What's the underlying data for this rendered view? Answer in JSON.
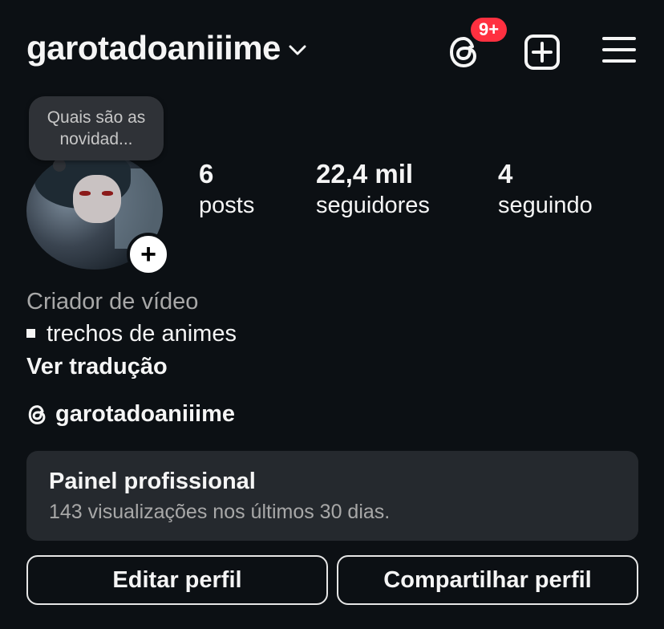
{
  "header": {
    "username": "garotadoaniiime",
    "threads_badge": "9+"
  },
  "note": {
    "text": "Quais são as novidad..."
  },
  "stats": {
    "posts": {
      "count": "6",
      "label": "posts"
    },
    "followers": {
      "count": "22,4 mil",
      "label": "seguidores"
    },
    "following": {
      "count": "4",
      "label": "seguindo"
    }
  },
  "bio": {
    "category": "Criador de vídeo",
    "line": "trechos de animes",
    "translate_label": "Ver tradução",
    "threads_handle": "garotadoaniiime"
  },
  "dashboard": {
    "title": "Painel profissional",
    "subtitle": "143 visualizações nos últimos 30 dias."
  },
  "actions": {
    "edit_label": "Editar perfil",
    "share_label": "Compartilhar perfil"
  },
  "colors": {
    "background": "#0c1014",
    "badge": "#ff3040",
    "panel": "#25292e"
  }
}
